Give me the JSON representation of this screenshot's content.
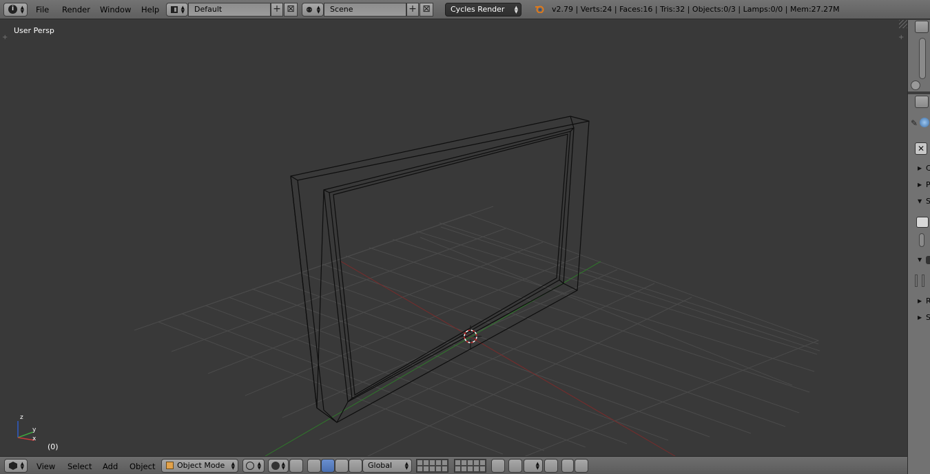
{
  "topbar": {
    "info_icon": "info-icon",
    "menus": [
      "File",
      "Render",
      "Window",
      "Help"
    ],
    "layout": {
      "value": "Default"
    },
    "scene": {
      "value": "Scene"
    },
    "engine": {
      "value": "Cycles Render"
    },
    "stats": "v2.79 | Verts:24 | Faces:16 | Tris:32 | Objects:0/3 | Lamps:0/0 | Mem:27.27M"
  },
  "viewport": {
    "view_label": "User Persp",
    "frame_label": "(0)",
    "axis": {
      "x": "x",
      "y": "y",
      "z": "z"
    }
  },
  "bottombar": {
    "menus": [
      "View",
      "Select",
      "Add",
      "Object"
    ],
    "mode": "Object Mode",
    "orientation": "Global"
  },
  "rpanel": {
    "letters": [
      "C",
      "P",
      "S",
      "R",
      "S"
    ]
  },
  "colors": {
    "background": "#393939",
    "grid": "#4a4a4a",
    "x_axis": "#8a2a2a",
    "y_axis": "#3a8a2a",
    "wire": "#0e0e0e",
    "header": "#727272"
  }
}
